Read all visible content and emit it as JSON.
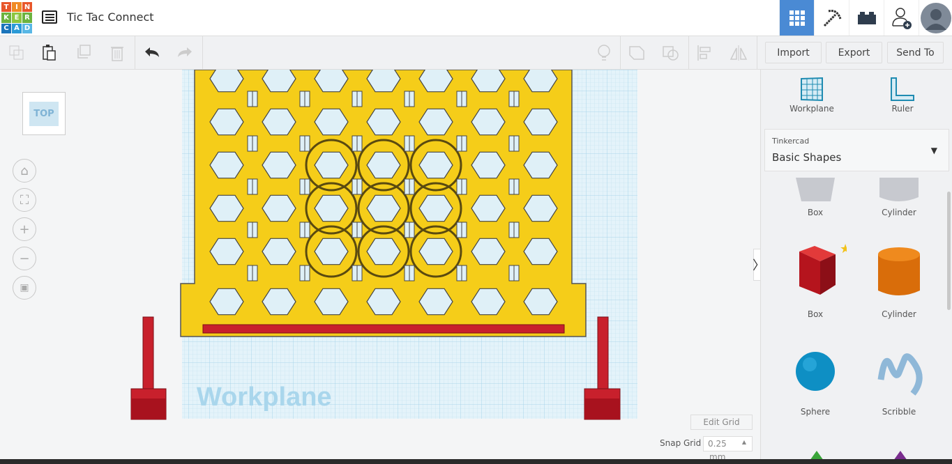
{
  "logo": {
    "letters": [
      "T",
      "I",
      "N",
      "K",
      "E",
      "R",
      "C",
      "A",
      "D"
    ],
    "colors": [
      "#e8562a",
      "#f08a24",
      "#e8562a",
      "#6cb33f",
      "#8cc63f",
      "#6cb33f",
      "#1b75bb",
      "#2b9ad6",
      "#58b7e5"
    ]
  },
  "header": {
    "title": "Tic Tac Connect",
    "icons": [
      "grid-view-icon",
      "pickaxe-icon",
      "brick-icon",
      "add-user-icon",
      "avatar"
    ]
  },
  "toolbar": {
    "import": "Import",
    "export": "Export",
    "send_to": "Send To"
  },
  "viewcube": {
    "label": "TOP"
  },
  "workplane_label": "Workplane",
  "sidebar": {
    "workplane": "Workplane",
    "ruler": "Ruler",
    "library_category": "Tinkercad",
    "library_name": "Basic Shapes",
    "shapes": [
      {
        "label": "Box"
      },
      {
        "label": "Cylinder"
      },
      {
        "label": "Box"
      },
      {
        "label": "Cylinder"
      },
      {
        "label": "Sphere"
      },
      {
        "label": "Scribble"
      }
    ]
  },
  "grid": {
    "edit_grid": "Edit Grid",
    "snap_grid_label": "Snap Grid",
    "snap_value": "0.25",
    "snap_unit": "mm"
  },
  "colors": {
    "accent": "#4a8ad4",
    "board": "#f5cd19",
    "red": "#c8202c",
    "grid": "#cde8f3"
  }
}
